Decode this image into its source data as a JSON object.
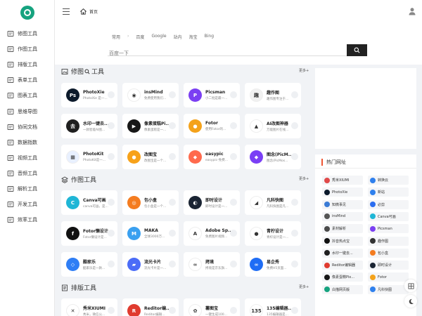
{
  "colors": {
    "accent": "#16a37f",
    "dark": "#222222"
  },
  "sidebar": {
    "logo_icon": "site-logo-icon",
    "items": [
      {
        "label": "修图工具",
        "icon": "image-icon"
      },
      {
        "label": "作图工具",
        "icon": "layers-icon"
      },
      {
        "label": "排版工具",
        "icon": "file-icon"
      },
      {
        "label": "表单工具",
        "icon": "form-icon"
      },
      {
        "label": "图表工具",
        "icon": "chart-icon"
      },
      {
        "label": "思维导图",
        "icon": "mindmap-icon"
      },
      {
        "label": "协同文档",
        "icon": "doc-icon"
      },
      {
        "label": "数据指数",
        "icon": "data-icon"
      },
      {
        "label": "视频工具",
        "icon": "video-icon"
      },
      {
        "label": "音频工具",
        "icon": "music-icon"
      },
      {
        "label": "解析工具",
        "icon": "parse-icon"
      },
      {
        "label": "开发工具",
        "icon": "code-icon"
      },
      {
        "label": "效率工具",
        "icon": "monitor-icon"
      }
    ]
  },
  "topbar": {
    "home_label": "首页"
  },
  "search": {
    "tabs": [
      "常用",
      "百度",
      "Google",
      "站内",
      "淘宝",
      "Bing"
    ],
    "placeholder": "百度一下"
  },
  "sections": [
    {
      "title": "修图",
      "title_suffix": "工具",
      "more": "更多+",
      "cards": [
        {
          "name": "PhotoXie",
          "desc": "PhotoXie 是一...",
          "color": "#0c1a2b",
          "glyph": "Ps"
        },
        {
          "name": "insMind",
          "desc": "免费使用我们...",
          "color": "#ffffff",
          "glyph": "◉"
        },
        {
          "name": "Picsman",
          "desc": "小二批是最一...",
          "color": "#7b3ff2",
          "glyph": "P"
        },
        {
          "name": "趣作图",
          "desc": "趣作图专注于...",
          "color": "#f1f1f1",
          "glyph": "趣"
        },
        {
          "name": "水印一键去...",
          "desc": "一款智能AI图...",
          "color": "#1f1f1f",
          "glyph": "去"
        },
        {
          "name": "像素蛋糕Pi...",
          "desc": "像素蛋糕是一...",
          "color": "#171717",
          "glyph": "▶"
        },
        {
          "name": "Fotor",
          "desc": "使用Fotor的...",
          "color": "#f4a21a",
          "glyph": "●"
        },
        {
          "name": "AI改图神器",
          "desc": "万能图片在线...",
          "color": "#ffffff",
          "glyph": "▲"
        },
        {
          "name": "PhotoKit",
          "desc": "PhotoKit是一...",
          "color": "#e8f0ff",
          "glyph": "▦"
        },
        {
          "name": "改图宝",
          "desc": "改图宝是一个...",
          "color": "#f7a21a",
          "glyph": "●"
        },
        {
          "name": "easypic",
          "desc": "easypic-免费...",
          "color": "#ff6a4d",
          "glyph": "◆"
        },
        {
          "name": "图念(PicM...",
          "desc": "图念(PicMos...",
          "color": "#7a3ff5",
          "glyph": "◆"
        }
      ]
    },
    {
      "title": "作图工具",
      "title_suffix": "",
      "more": "更多+",
      "cards": [
        {
          "name": "Canva可画",
          "desc": "canva可画，是...",
          "color": "#1fb6d6",
          "glyph": "C"
        },
        {
          "name": "包小盒",
          "desc": "包小盒是一个...",
          "color": "#f47c20",
          "glyph": "◎"
        },
        {
          "name": "即时设计",
          "desc": "即时设计是一...",
          "color": "#1a2433",
          "glyph": "◐"
        },
        {
          "name": "凡科快图",
          "desc": "凡科快图是凡...",
          "color": "#ffffff",
          "glyph": "◢"
        },
        {
          "name": "Fotor懒设计",
          "desc": "Fotor懒设计是...",
          "color": "#111111",
          "glyph": "f"
        },
        {
          "name": "MAKA",
          "desc": "全球3000万...",
          "color": "#3aa0f0",
          "glyph": "M"
        },
        {
          "name": "Adobe Sp...",
          "desc": "免费图片视频...",
          "color": "#ffffff",
          "glyph": "A"
        },
        {
          "name": "青柠设计",
          "desc": "青柠设计是一...",
          "color": "#ffffff",
          "glyph": "●"
        },
        {
          "name": "酷家乐",
          "desc": "酷家乐是一款...",
          "color": "#2f7ef5",
          "glyph": "◇"
        },
        {
          "name": "流光卡片",
          "desc": "流光卡片是一...",
          "color": "#4b6cf7",
          "glyph": "▰"
        },
        {
          "name": "拷境",
          "desc": "拷境是京东旗...",
          "color": "#ffffff",
          "glyph": "∞"
        },
        {
          "name": "易企秀",
          "desc": "免费H5页面...",
          "color": "#1f6df5",
          "glyph": "∞"
        }
      ]
    },
    {
      "title": "排版工具",
      "title_suffix": "",
      "more": "更多+",
      "cards": [
        {
          "name": "秀米XIUMI",
          "desc": "秀米，微信公...",
          "color": "#ffffff",
          "glyph": "✕"
        },
        {
          "name": "Reditor编...",
          "desc": "Reditor编辑...",
          "color": "#e03b2f",
          "glyph": "R"
        },
        {
          "name": "薯图宝",
          "desc": "一键生成100...",
          "color": "#ffffff",
          "glyph": "✿"
        },
        {
          "name": "135编辑器...",
          "desc": "135编辑器是...",
          "color": "#ffffff",
          "glyph": "135"
        }
      ]
    }
  ],
  "hot": {
    "title": "热门网址",
    "items": [
      {
        "label": "秀米XIUMI",
        "color": "#e04a4a"
      },
      {
        "label": "转换云",
        "color": "#2f80ed"
      },
      {
        "label": "PhotoXie",
        "color": "#0c1a2b"
      },
      {
        "label": "新站",
        "color": "#2f80ed"
      },
      {
        "label": "知微事见",
        "color": "#3a7bd5"
      },
      {
        "label": "必剪",
        "color": "#2b6df0"
      },
      {
        "label": "insMind",
        "color": "#555555"
      },
      {
        "label": "Canva可画",
        "color": "#1fb6d6"
      },
      {
        "label": "素材解析",
        "color": "#4a4a4a"
      },
      {
        "label": "Picsman",
        "color": "#7b3ff2"
      },
      {
        "label": "抖音热点宝",
        "color": "#111111"
      },
      {
        "label": "趣作图",
        "color": "#333333"
      },
      {
        "label": "水印一键去...",
        "color": "#1f1f1f"
      },
      {
        "label": "包小盒",
        "color": "#f47c20"
      },
      {
        "label": "Reditor编辑器",
        "color": "#e03b2f"
      },
      {
        "label": "即时设计",
        "color": "#1a2433"
      },
      {
        "label": "像素蛋糕Pix...",
        "color": "#171717"
      },
      {
        "label": "Fotor",
        "color": "#f4a21a"
      },
      {
        "label": "白描网页版",
        "color": "#16a37f"
      },
      {
        "label": "凡科快图",
        "color": "#2f80ed"
      }
    ]
  }
}
